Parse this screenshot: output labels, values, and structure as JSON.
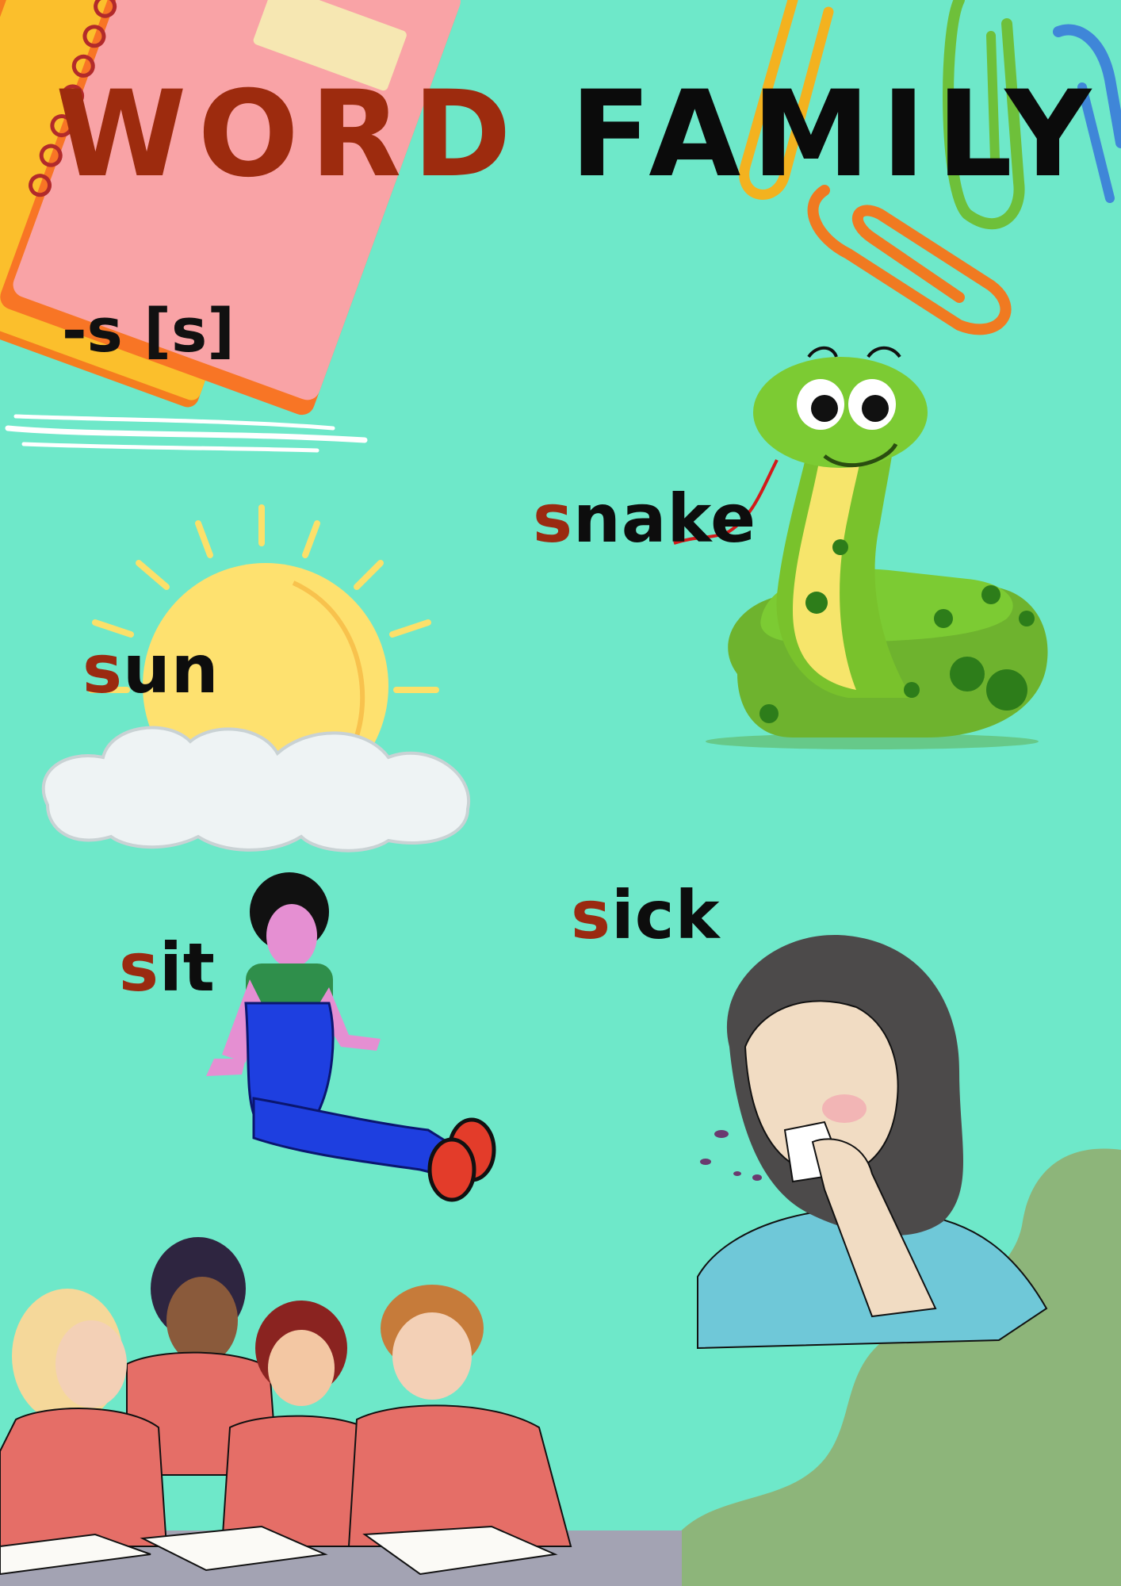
{
  "title": {
    "word1": "WORD",
    "word2": "FAMILY"
  },
  "rule": "-s [s]",
  "words": [
    {
      "key": "snake",
      "first": "s",
      "rest": "nake"
    },
    {
      "key": "sun",
      "first": "s",
      "rest": "un"
    },
    {
      "key": "sit",
      "first": "s",
      "rest": "it"
    },
    {
      "key": "sick",
      "first": "s",
      "rest": "ick"
    }
  ],
  "colors": {
    "background": "#6ee8c9",
    "title_word1": "#9d2b0e",
    "title_word2": "#0b0b0b",
    "first_letter": "#9a2a10",
    "blob": "#8db57a"
  },
  "illustrations": [
    "notebook-icon",
    "paperclip-icon",
    "snake-icon",
    "sun-icon",
    "cloud-icon",
    "sitting-girl-icon",
    "sneezing-woman-icon",
    "students-group-icon"
  ]
}
